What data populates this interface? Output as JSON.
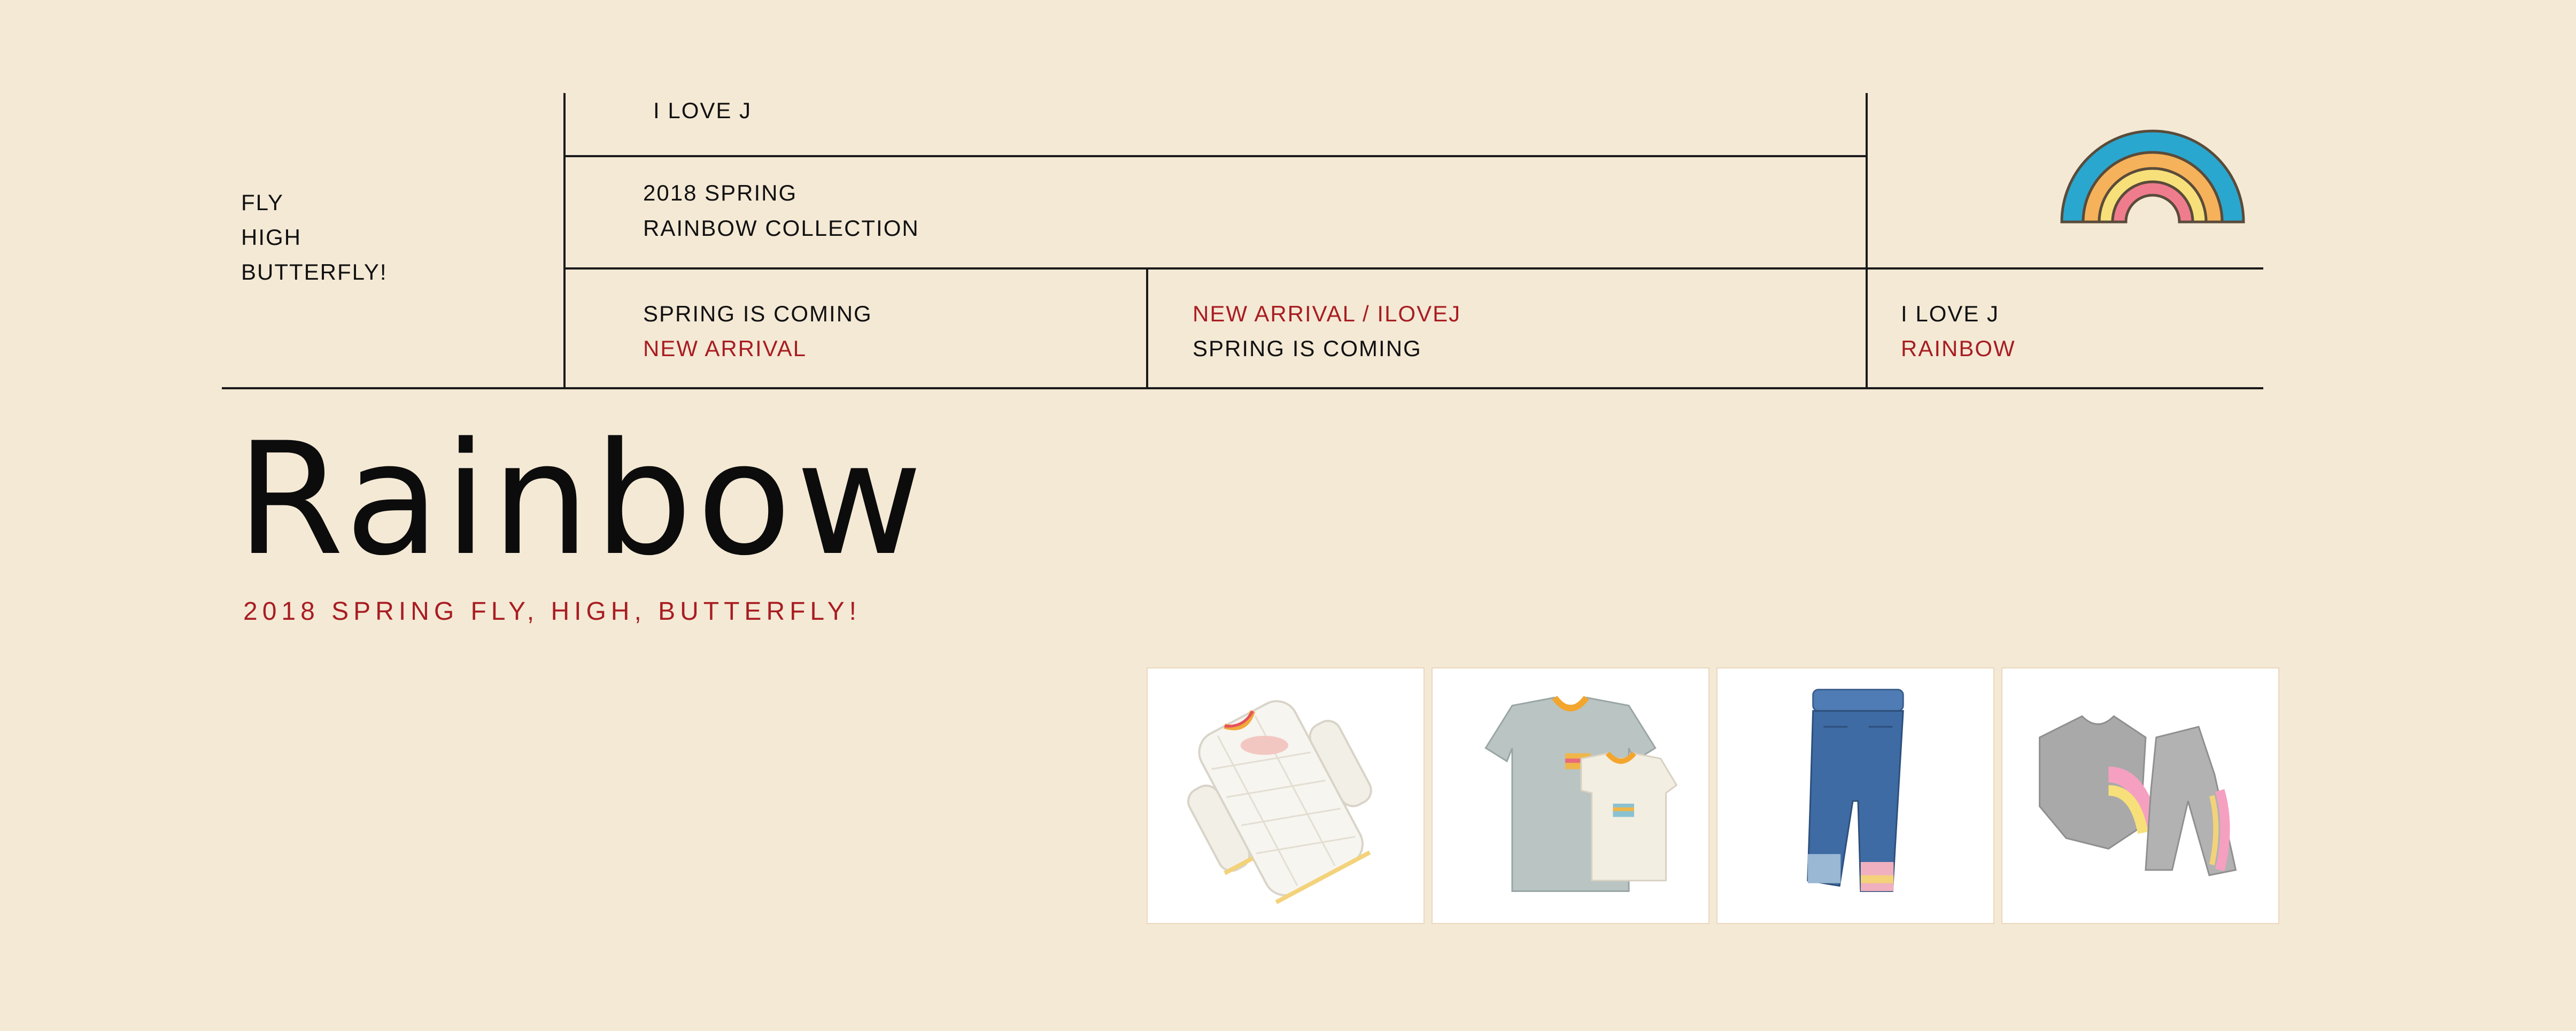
{
  "header": {
    "left_tagline": [
      "FLY",
      "HIGH",
      "BUTTERFLY!"
    ],
    "brand": "I LOVE J",
    "collection": [
      "2018 SPRING",
      "RAINBOW COLLECTION"
    ],
    "cell_a": {
      "line1": "SPRING IS COMING",
      "line2": "NEW ARRIVAL"
    },
    "cell_b": {
      "line1": "NEW ARRIVAL / ILOVEJ",
      "line2": "SPRING IS COMING"
    },
    "cell_c": {
      "line1": "I LOVE J",
      "line2": "RAINBOW"
    },
    "logo_icon": "rainbow-icon"
  },
  "hero": {
    "title": "Rainbow",
    "subtitle": "2018 SPRING FLY, HIGH, BUTTERFLY!"
  },
  "products": [
    {
      "icon": "quilted-coat-image"
    },
    {
      "icon": "tshirt-set-image"
    },
    {
      "icon": "denim-jeans-image"
    },
    {
      "icon": "rainbow-sweatsuit-image"
    }
  ],
  "colors": {
    "background": "#f4e9d5",
    "accent_red": "#a81d22",
    "rainbow_blue": "#2aa7cf",
    "rainbow_orange": "#f5b25a",
    "rainbow_yellow": "#f7e07a",
    "rainbow_pink": "#ef7c8d"
  }
}
